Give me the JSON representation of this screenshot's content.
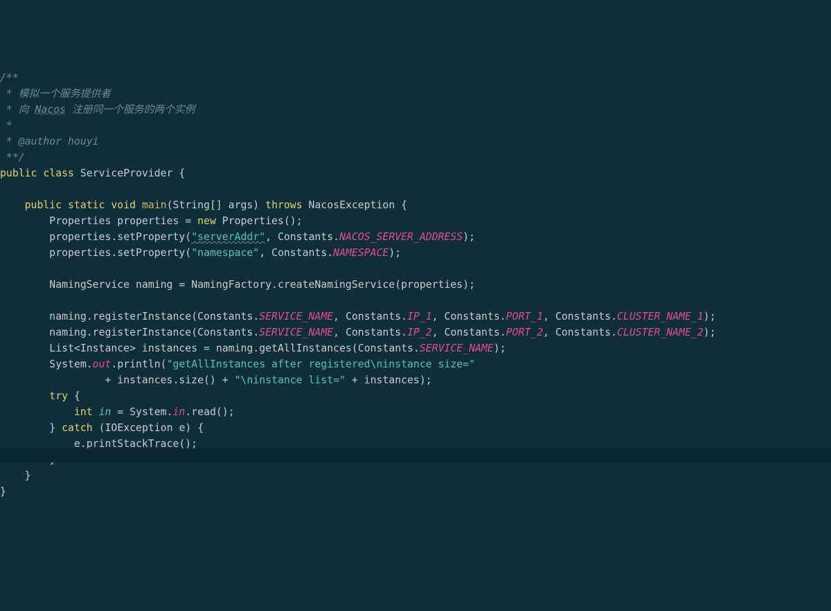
{
  "code": {
    "jd_open": "/**",
    "jd_l1a": " * ",
    "jd_l1b": "模拟一个服务提供者",
    "jd_l2a": " * 向 ",
    "jd_l2b": "Nacos",
    "jd_l2c": " 注册同一个服务的两个实例",
    "jd_l3": " *",
    "jd_l4a": " * ",
    "jd_l4b": "@author houyi",
    "jd_close": " **/",
    "kw_public": "public",
    "kw_class": "class",
    "class_name": "ServiceProvider",
    "kw_static": "static",
    "kw_void": "void",
    "method_main": "main",
    "sig_args": "(String[] args)",
    "kw_throws": "throws",
    "exc_nacos": "NacosException",
    "brace_open": "{",
    "brace_close": "}",
    "type_properties": "Properties",
    "var_properties": "properties",
    "eq": " = ",
    "kw_new": "new",
    "ctor_props": "Properties()",
    "semi": ";",
    "call_setprop": "setProperty",
    "str_serverAddr": "\"serverAddr\"",
    "str_namespace": "\"namespace\"",
    "const_class": "Constants",
    "dot": ".",
    "const_nacos_addr": "NACOS_SERVER_ADDRESS",
    "const_namespace": "NAMESPACE",
    "type_naming": "NamingService",
    "var_naming": "naming",
    "nf": "NamingFactory",
    "create_ns": "createNamingService",
    "reg_inst": "registerInstance",
    "const_service_name": "SERVICE_NAME",
    "const_ip1": "IP_1",
    "const_ip2": "IP_2",
    "const_port1": "PORT_1",
    "const_port2": "PORT_2",
    "const_cluster1": "CLUSTER_NAME_1",
    "const_cluster2": "CLUSTER_NAME_2",
    "type_list": "List<Instance>",
    "var_instances": "instances",
    "get_all_inst": "getAllInstances",
    "sys": "System",
    "out": "out",
    "println": "println",
    "str_getall": "\"getAllInstances after registered\\ninstance size=\"",
    "plus": " + ",
    "call_size": "instances.size()",
    "str_instlist": "\"\\ninstance list=\"",
    "var_inst2": "instances",
    "kw_try": "try",
    "kw_int": "int",
    "var_in": "in",
    "field_in": "in",
    "call_read": "read()",
    "kw_catch": "catch",
    "type_ioe": "IOException",
    "var_e": "e",
    "call_pst": "e.printStackTrace()",
    "lparen": "(",
    "rparen": ")",
    "comma": ", "
  }
}
